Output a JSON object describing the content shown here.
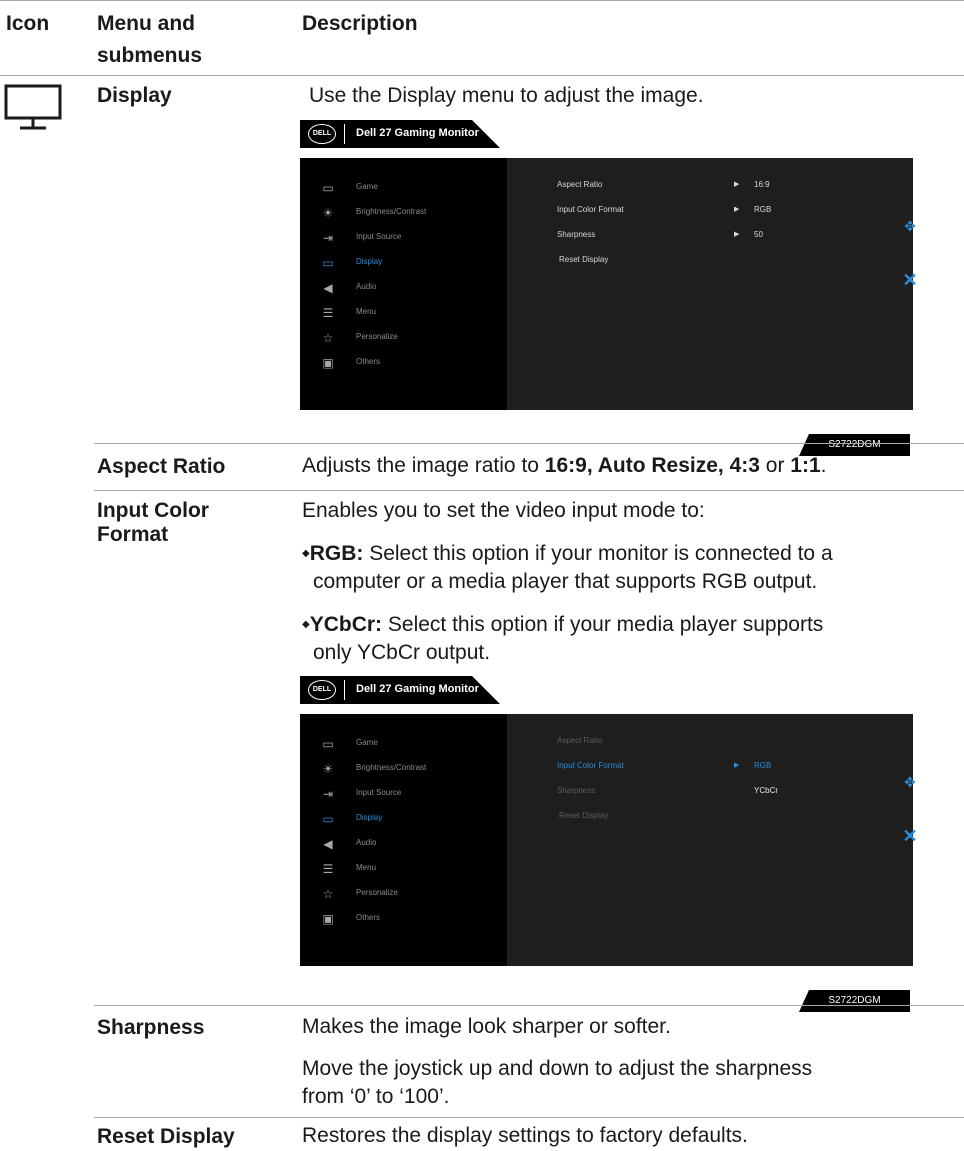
{
  "table": {
    "headers": {
      "icon": "Icon",
      "menu_line1": "Menu and",
      "menu_line2": "submenus",
      "description": "Description"
    }
  },
  "display": {
    "menu": "Display",
    "intro": "Use the Display menu to adjust the image.",
    "icon": "monitor-icon"
  },
  "osd1": {
    "brand": "DELL",
    "title": "Dell 27 Gaming Monitor",
    "nav": [
      {
        "label": "Game",
        "icon": "game-icon"
      },
      {
        "label": "Brightness/Contrast",
        "icon": "brightness-icon"
      },
      {
        "label": "Input Source",
        "icon": "input-source-icon"
      },
      {
        "label": "Display",
        "icon": "display-icon"
      },
      {
        "label": "Audio",
        "icon": "audio-icon"
      },
      {
        "label": "Menu",
        "icon": "menu-icon"
      },
      {
        "label": "Personalize",
        "icon": "star-icon"
      },
      {
        "label": "Others",
        "icon": "others-icon"
      }
    ],
    "options": [
      {
        "label": "Aspect Ratio",
        "value": "16:9"
      },
      {
        "label": "Input Color Format",
        "value": "RGB"
      },
      {
        "label": "Sharpness",
        "value": "50"
      },
      {
        "label": "Reset Display",
        "value": ""
      }
    ],
    "model": "S2722DGM"
  },
  "osd2": {
    "brand": "DELL",
    "title": "Dell 27 Gaming Monitor",
    "options": [
      {
        "label": "Aspect Ratio",
        "value": ""
      },
      {
        "label": "Input Color Format",
        "value": "RGB"
      },
      {
        "label": "Sharpness",
        "value": "YCbCr"
      },
      {
        "label": "Reset Display",
        "value": ""
      }
    ],
    "model": "S2722DGM"
  },
  "rows": {
    "aspect": {
      "menu": "Aspect Ratio",
      "pre": "Adjusts the image ratio to ",
      "bold1": "16:9, Auto Resize, 4:3",
      "mid": " or ",
      "bold2": "1:1",
      "post": "."
    },
    "icf": {
      "menu_line1": "Input Color",
      "menu_line2": "Format",
      "intro": "Enables you to set the video input mode to:",
      "b1_bold": "RGB:",
      "b1_line1": " Select this option if your monitor is connected to a",
      "b1_line2": "computer or a media player that supports RGB output.",
      "b2_bold": "YCbCr:",
      "b2_line1": " Select this option if your media player supports",
      "b2_line2": "only YCbCr output."
    },
    "sharpness": {
      "menu": "Sharpness",
      "line1": "Makes the image look sharper or softer.",
      "line2a": "Move the joystick up and down to adjust the sharpness",
      "line2b": "from ‘0’ to ‘100’."
    },
    "reset": {
      "menu": "Reset Display",
      "desc": "Restores the display settings to factory defaults."
    }
  }
}
